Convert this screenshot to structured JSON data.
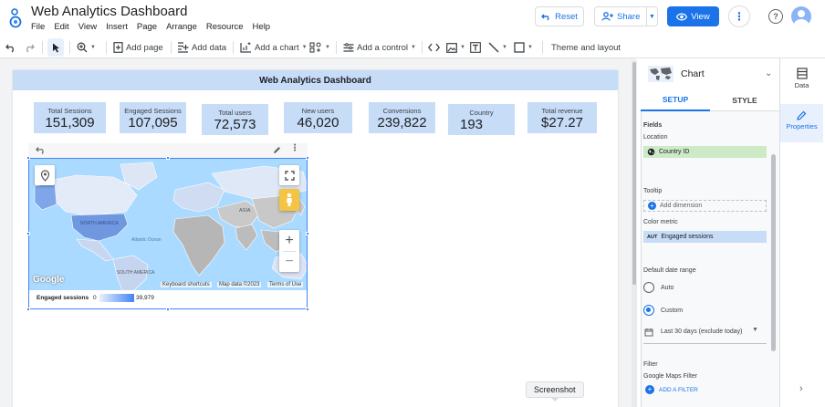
{
  "header": {
    "title": "Web Analytics Dashboard",
    "menu": [
      "File",
      "Edit",
      "View",
      "Insert",
      "Page",
      "Arrange",
      "Resource",
      "Help"
    ],
    "reset_label": "Reset",
    "share_label": "Share",
    "view_label": "View"
  },
  "toolbar": {
    "zoom_icon": "zoom-in-icon",
    "add_page": "Add page",
    "add_data": "Add data",
    "add_chart": "Add a chart",
    "add_control": "Add a control",
    "theme_layout": "Theme and layout"
  },
  "report": {
    "banner": "Web Analytics Dashboard",
    "kpis": [
      {
        "label": "Total Sessions",
        "value": "151,309"
      },
      {
        "label": "Engaged Sessions",
        "value": "107,095"
      },
      {
        "label": "Total users",
        "value": "72,573"
      },
      {
        "label": "New users",
        "value": "46,020"
      },
      {
        "label": "Conversions",
        "value": "239,822"
      },
      {
        "label": "Country",
        "value": "193"
      },
      {
        "label": "Total revenue",
        "value": "$27.27"
      }
    ],
    "map": {
      "labels": {
        "asia": "ASIA",
        "north_america": "NORTH AMERICA",
        "south_america": "SOUTH AMERICA",
        "atlantic": "Atlantic Ocean"
      },
      "brand": "Google",
      "keyboard_shortcuts": "Keyboard shortcuts",
      "map_data": "Map data ©2023",
      "terms": "Terms of Use",
      "legend_metric": "Engaged sessions",
      "legend_min": "0",
      "legend_max": "39,979"
    }
  },
  "properties": {
    "chart_type": "Chart",
    "tab_setup": "SETUP",
    "tab_style": "STYLE",
    "fields_heading": "Fields",
    "location_label": "Location",
    "location_value": "Country ID",
    "tooltip_label": "Tooltip",
    "add_dimension": "Add dimension",
    "color_metric_label": "Color metric",
    "color_metric_badge": "AUT",
    "color_metric_value": "Engaged sessions",
    "date_range_label": "Default date range",
    "auto_label": "Auto",
    "custom_label": "Custom",
    "date_value": "Last 30 days (exclude today)",
    "filter_heading": "Filter",
    "gmaps_filter": "Google Maps Filter",
    "add_filter": "ADD A FILTER"
  },
  "rail": {
    "data": "Data",
    "properties": "Properties"
  },
  "tooltip": "Screenshot",
  "colors": {
    "accent": "#1a73e8",
    "banner": "#c6dcf7",
    "field_green": "#cdeac6",
    "field_blue": "#c6dcf7"
  }
}
